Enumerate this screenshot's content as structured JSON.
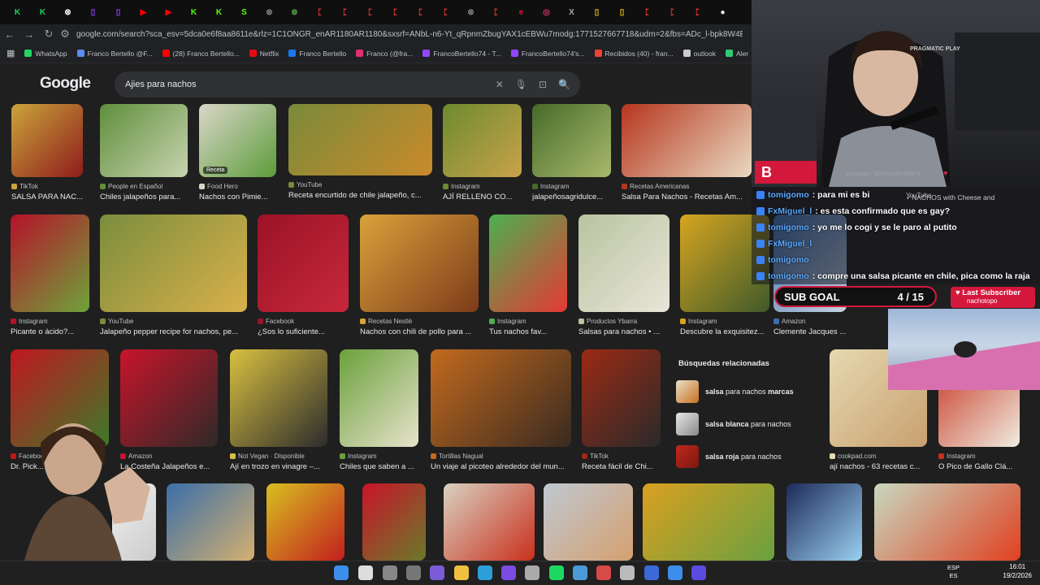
{
  "browser": {
    "tab_letters": [
      "K",
      "K",
      "⊗",
      "▯",
      "▯",
      "▶",
      "▶",
      "K",
      "K",
      "S",
      "⊗",
      "⊗",
      "ᛈ",
      "ᛈ",
      "ᛈ",
      "ᛈ",
      "ᛈ",
      "ᛈ",
      "⊗",
      "ᛈ",
      "e",
      "◎",
      "X",
      "▯",
      "▯",
      "ᛈ",
      "ᛈ",
      "ᛈ",
      "●"
    ],
    "url": "google.com/search?sca_esv=5dca0e6f8aa8611e&rlz=1C1ONGR_enAR1180AR1180&sxsrf=ANbL-n6-Yt_qRpnmZbugYAX1cEBWu7modg:1771527667718&udm=2&fbs=ADc_l-bpk8W4E-qsVlOvbGJcDwp",
    "bookmarks": [
      {
        "label": "WhatsApp",
        "color": "#25d366"
      },
      {
        "label": "Franco Bertello @F...",
        "color": "#5b8def"
      },
      {
        "label": "(28) Franco Bertello...",
        "color": "#ff0000"
      },
      {
        "label": "Netflix",
        "color": "#e50914"
      },
      {
        "label": "Franco Bertello",
        "color": "#1877f2"
      },
      {
        "label": "Franco (@fra...",
        "color": "#e1306c"
      },
      {
        "label": "FrancoBertello74 - T...",
        "color": "#9146ff"
      },
      {
        "label": "FrancoBertello74's...",
        "color": "#9146ff"
      },
      {
        "label": "Recibidos (40) - fran...",
        "color": "#ea4335"
      },
      {
        "label": "outlook",
        "color": "#cccccc"
      },
      {
        "label": "Aler",
        "color": "#2ecc71"
      }
    ]
  },
  "google": {
    "logo": "Google",
    "query": "Ajies para nachos"
  },
  "results": [
    {
      "src": "TikTok",
      "cap": "SALSA PARA NAC...",
      "badge": "",
      "c1": "#caa43a",
      "c2": "#8e1c1c"
    },
    {
      "src": "People en Español",
      "cap": "Chiles jalapeños para...",
      "badge": "",
      "c1": "#5f8f3b",
      "c2": "#c8d3b0"
    },
    {
      "src": "Food Hero",
      "cap": "Nachos con Pimie...",
      "badge": "Receta",
      "c1": "#d9d6c8",
      "c2": "#5d9c3a"
    },
    {
      "src": "YouTube",
      "cap": "Receta encurtido de chile jalapeño, c...",
      "badge": "",
      "c1": "#7a8a3a",
      "c2": "#c98a2a"
    },
    {
      "src": "Instagram",
      "cap": "AJÍ RELLENO CO...",
      "badge": "",
      "c1": "#6d8b2f",
      "c2": "#c9a24a"
    },
    {
      "src": "Instagram",
      "cap": "jalapeñosagridulce...",
      "badge": "",
      "c1": "#476b2a",
      "c2": "#a8b96b"
    },
    {
      "src": "Recetas Americanas",
      "cap": "Salsa Para Nachos - Recetas Am...",
      "badge": "",
      "c1": "#b7351e",
      "c2": "#e8d9c0"
    },
    {
      "src": "Instagram",
      "cap": "Picante o ácido?...",
      "badge": "",
      "c1": "#b5122a",
      "c2": "#6fa33a"
    },
    {
      "src": "YouTube",
      "cap": "Jalapeño pepper recipe for nachos, pe...",
      "badge": "",
      "c1": "#7a8d3c",
      "c2": "#d9b04a"
    },
    {
      "src": "Facebook",
      "cap": "¿Sos lo suficiente...",
      "badge": "",
      "c1": "#9b1226",
      "c2": "#c7283b"
    },
    {
      "src": "Recetas Nestlé",
      "cap": "Nachos con chili de pollo para ...",
      "badge": "",
      "c1": "#d9a23a",
      "c2": "#7d3b1a"
    },
    {
      "src": "Instagram",
      "cap": "Tus nachos fav...",
      "badge": "",
      "c1": "#4caf50",
      "c2": "#e53935"
    },
    {
      "src": "Productos Ybarra",
      "cap": "Salsas para nachos • ...",
      "badge": "",
      "c1": "#b9c4a0",
      "c2": "#e8e5d8"
    },
    {
      "src": "Instagram",
      "cap": "Descubre la exquisitez...",
      "badge": "",
      "c1": "#d6a520",
      "c2": "#3f5a2a"
    },
    {
      "src": "Amazon",
      "cap": "Clemente Jacques ...",
      "badge": "",
      "c1": "#3a6fb0",
      "c2": "#c8d2df"
    },
    {
      "src": "Facebook",
      "cap": "Dr. Pick... add...",
      "badge": "",
      "c1": "#c0171f",
      "c2": "#3d7a2a"
    },
    {
      "src": "Amazon",
      "cap": "La Costeña Jalapeños e...",
      "badge": "",
      "c1": "#c8142a",
      "c2": "#2e2a28"
    },
    {
      "src": "Not Vegan · Disponible",
      "cap": "Ají en trozo en vinagre –...",
      "badge": "",
      "c1": "#d9c040",
      "c2": "#2c2c2c"
    },
    {
      "src": "Instagram",
      "cap": "Chiles que saben a ...",
      "badge": "",
      "c1": "#6aa13a",
      "c2": "#e8e2cc"
    },
    {
      "src": "Tortillas Nagual",
      "cap": "Un viaje al picoteo alrededor del mun...",
      "badge": "",
      "c1": "#c26a1e",
      "c2": "#3a2a20"
    },
    {
      "src": "TikTok",
      "cap": "Receta fácil de Chi...",
      "badge": "",
      "c1": "#9c2a14",
      "c2": "#2a2a2a"
    },
    {
      "src": "cookpad.com",
      "cap": "ají nachos - 63 recetas c...",
      "badge": "",
      "c1": "#e6d8b0",
      "c2": "#c8a070"
    },
    {
      "src": "Instagram",
      "cap": "O Pico de Gallo Clá...",
      "badge": "",
      "c1": "#c6301c",
      "c2": "#f0ece0"
    }
  ],
  "related": {
    "heading": "Búsquedas relacionadas",
    "items": [
      {
        "pre": "salsa",
        "mid": " para nachos ",
        "bold": "marcas"
      },
      {
        "pre": "salsa blanca",
        "mid": " para nachos",
        "bold": ""
      },
      {
        "pre": "salsa roja",
        "mid": " para nachos",
        "bold": ""
      }
    ]
  },
  "row4": [
    {
      "c1": "#f0f0f0",
      "c2": "#cccccc"
    },
    {
      "c1": "#3a6ea8",
      "c2": "#d4b070"
    },
    {
      "c1": "#d8c020",
      "c2": "#c21e1e"
    },
    {
      "c1": "#c8142a",
      "c2": "#6a7a2a"
    },
    {
      "c1": "#d9d0c0",
      "c2": "#c8301c"
    },
    {
      "c1": "#c0c8d0",
      "c2": "#d4a070"
    },
    {
      "c1": "#d9a020",
      "c2": "#6aa040"
    },
    {
      "c1": "#1d2a5a",
      "c2": "#9ad0f0"
    },
    {
      "c1": "#c8d8c0",
      "c2": "#e04020"
    }
  ],
  "stream": {
    "watermark": "Instagram: @francobertello74",
    "sponsor": "PRAGMATIC PLAY",
    "chat": [
      {
        "user": "tomigomo",
        "msg": ": para mi es bi"
      },
      {
        "user": "FxMiguel_l",
        "msg": ": es esta confirmado que es gay?"
      },
      {
        "user": "tomigomo",
        "msg": ": yo me lo cogi y se le paro al putito"
      },
      {
        "user": "FxMiguel_l",
        "msg": ""
      },
      {
        "user": "tomigomo",
        "msg": ""
      },
      {
        "user": "tomigomo",
        "msg": ": compre una salsa picante en chile, pica como la raja"
      }
    ],
    "overlay_caption": "✓NACHOS with Cheese and",
    "overlay_src": "YouTube",
    "subgoal_label": "SUB GOAL",
    "subgoal_count": "4 / 15",
    "lastsub_label": "Last Subscriber",
    "lastsub_name": "nachotopo"
  },
  "taskbar": {
    "lang_top": "ESP",
    "lang_bot": "ES",
    "time": "16:01",
    "date": "19/2/2026"
  }
}
